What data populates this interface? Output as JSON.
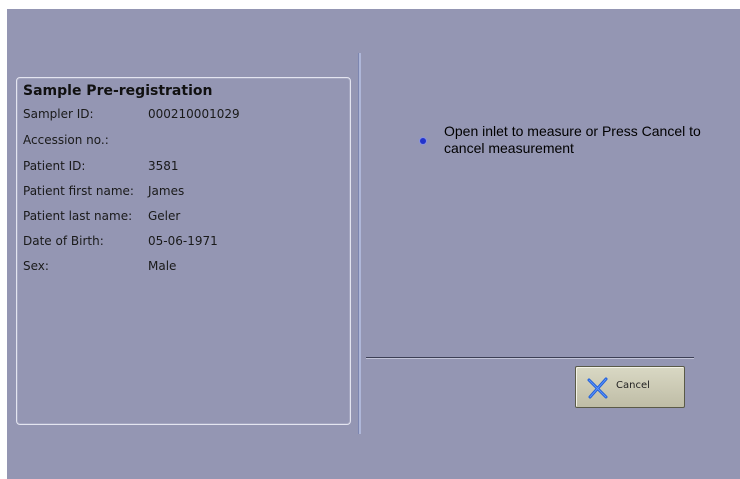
{
  "registration": {
    "title": "Sample Pre-registration",
    "fields": [
      {
        "label": "Sampler ID:",
        "value": "000210001029"
      },
      {
        "label": "Accession no.:",
        "value": ""
      },
      {
        "label": "Patient ID:",
        "value": "3581"
      },
      {
        "label": "Patient first name:",
        "value": "James"
      },
      {
        "label": "Patient last name:",
        "value": "Geler"
      },
      {
        "label": "Date of Birth:",
        "value": "05-06-1971"
      },
      {
        "label": "Sex:",
        "value": "Male"
      }
    ]
  },
  "message": {
    "text": "Open inlet to measure or Press Cancel to cancel measurement",
    "bullet_color": "#2233cc"
  },
  "actions": {
    "cancel_label": "Cancel",
    "cancel_icon": "x-icon",
    "cancel_icon_color": "#1f5fd6"
  },
  "colors": {
    "background": "#9496b3",
    "button_face": "#cfcdb6"
  }
}
